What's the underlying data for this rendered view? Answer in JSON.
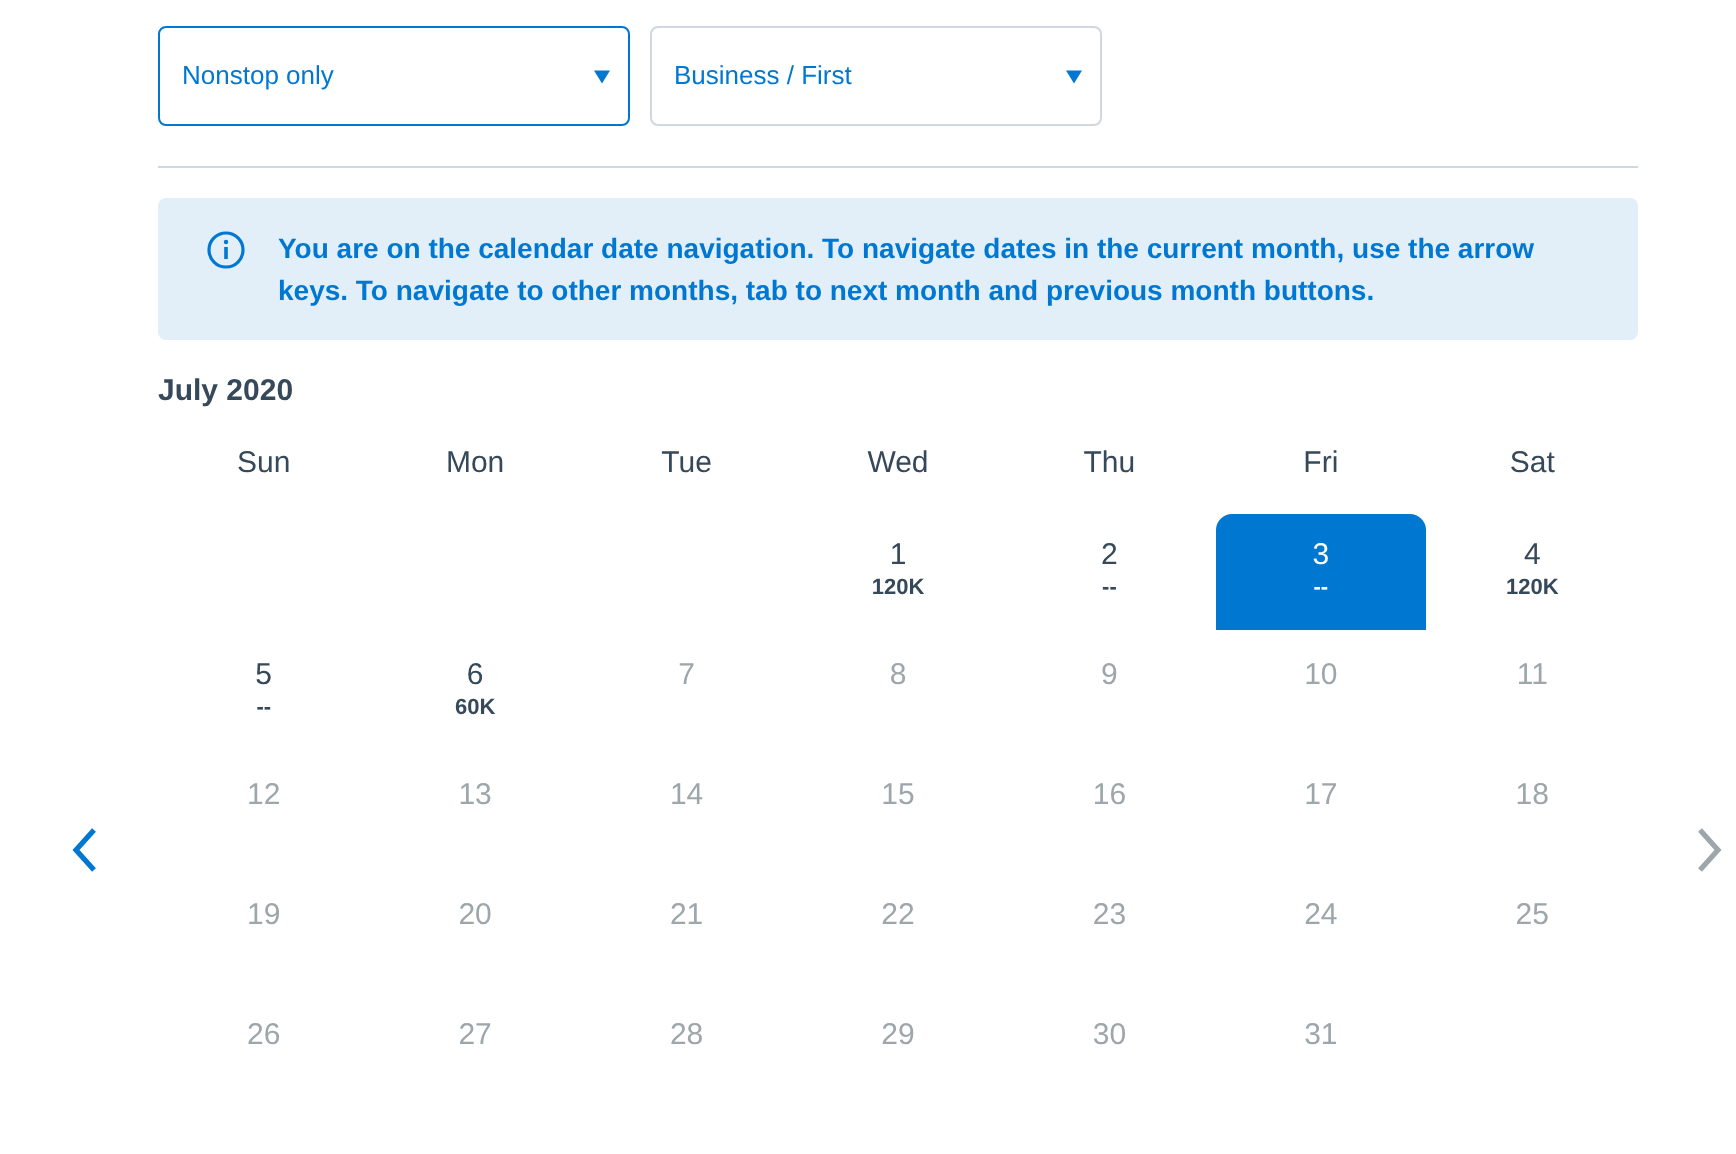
{
  "filters": [
    {
      "value": "Nonstop only",
      "focused": true
    },
    {
      "value": "Business / First",
      "focused": false
    }
  ],
  "notice": "You are on the calendar date navigation. To navigate dates in the current month, use the arrow keys. To navigate to other months, tab to next month and previous month buttons.",
  "month": "July 2020",
  "prev_month": {
    "disabled": false
  },
  "next_month": {
    "disabled": true
  },
  "weekdays": [
    "Sun",
    "Mon",
    "Tue",
    "Wed",
    "Thu",
    "Fri",
    "Sat"
  ],
  "days": [
    {
      "kind": "blank"
    },
    {
      "kind": "blank"
    },
    {
      "kind": "blank"
    },
    {
      "kind": "day",
      "number": "1",
      "price": "120K",
      "disabled": false,
      "selected": false
    },
    {
      "kind": "day",
      "number": "2",
      "price": "--",
      "disabled": false,
      "selected": false
    },
    {
      "kind": "day",
      "number": "3",
      "price": "--",
      "disabled": false,
      "selected": true
    },
    {
      "kind": "day",
      "number": "4",
      "price": "120K",
      "disabled": false,
      "selected": false
    },
    {
      "kind": "day",
      "number": "5",
      "price": "--",
      "disabled": false,
      "selected": false
    },
    {
      "kind": "day",
      "number": "6",
      "price": "60K",
      "disabled": false,
      "selected": false
    },
    {
      "kind": "day",
      "number": "7",
      "disabled": true,
      "selected": false
    },
    {
      "kind": "day",
      "number": "8",
      "disabled": true,
      "selected": false
    },
    {
      "kind": "day",
      "number": "9",
      "disabled": true,
      "selected": false
    },
    {
      "kind": "day",
      "number": "10",
      "disabled": true,
      "selected": false
    },
    {
      "kind": "day",
      "number": "11",
      "disabled": true,
      "selected": false
    },
    {
      "kind": "day",
      "number": "12",
      "disabled": true,
      "selected": false
    },
    {
      "kind": "day",
      "number": "13",
      "disabled": true,
      "selected": false
    },
    {
      "kind": "day",
      "number": "14",
      "disabled": true,
      "selected": false
    },
    {
      "kind": "day",
      "number": "15",
      "disabled": true,
      "selected": false
    },
    {
      "kind": "day",
      "number": "16",
      "disabled": true,
      "selected": false
    },
    {
      "kind": "day",
      "number": "17",
      "disabled": true,
      "selected": false
    },
    {
      "kind": "day",
      "number": "18",
      "disabled": true,
      "selected": false
    },
    {
      "kind": "day",
      "number": "19",
      "disabled": true,
      "selected": false
    },
    {
      "kind": "day",
      "number": "20",
      "disabled": true,
      "selected": false
    },
    {
      "kind": "day",
      "number": "21",
      "disabled": true,
      "selected": false
    },
    {
      "kind": "day",
      "number": "22",
      "disabled": true,
      "selected": false
    },
    {
      "kind": "day",
      "number": "23",
      "disabled": true,
      "selected": false
    },
    {
      "kind": "day",
      "number": "24",
      "disabled": true,
      "selected": false
    },
    {
      "kind": "day",
      "number": "25",
      "disabled": true,
      "selected": false
    },
    {
      "kind": "day",
      "number": "26",
      "disabled": true,
      "selected": false
    },
    {
      "kind": "day",
      "number": "27",
      "disabled": true,
      "selected": false
    },
    {
      "kind": "day",
      "number": "28",
      "disabled": true,
      "selected": false
    },
    {
      "kind": "day",
      "number": "29",
      "disabled": true,
      "selected": false
    },
    {
      "kind": "day",
      "number": "30",
      "disabled": true,
      "selected": false
    },
    {
      "kind": "day",
      "number": "31",
      "disabled": true,
      "selected": false
    }
  ]
}
